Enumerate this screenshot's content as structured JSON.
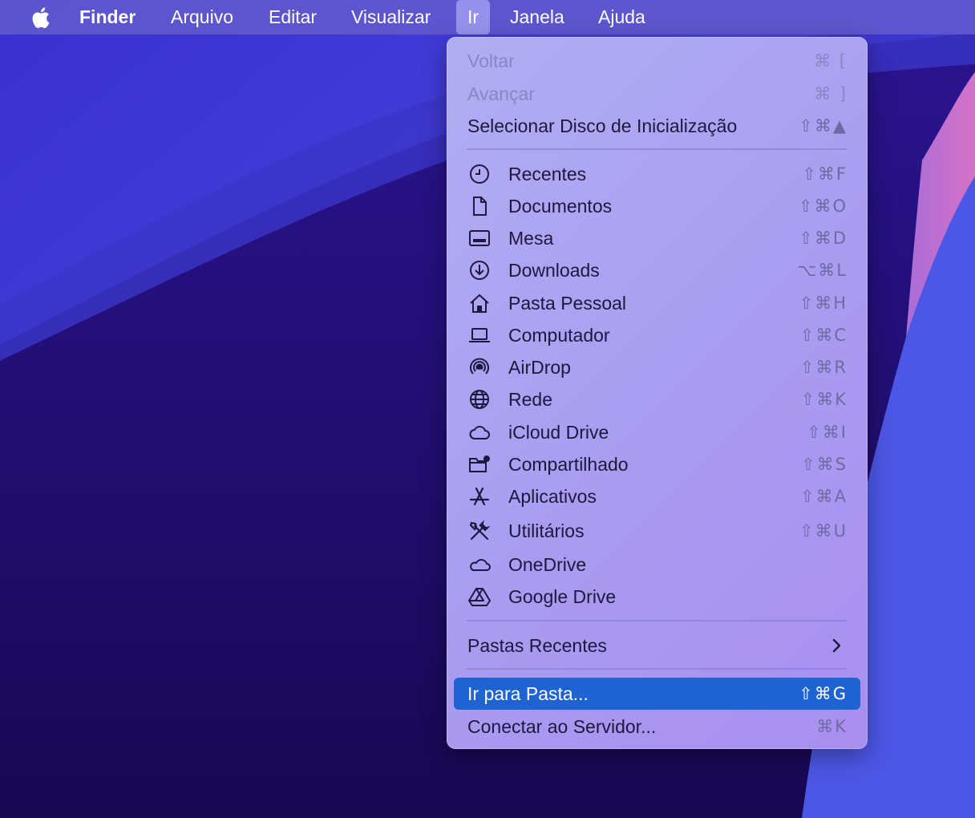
{
  "menubar": {
    "apple_icon": "apple-logo-icon",
    "items": [
      {
        "label": "Finder"
      },
      {
        "label": "Arquivo"
      },
      {
        "label": "Editar"
      },
      {
        "label": "Visualizar"
      },
      {
        "label": "Ir"
      },
      {
        "label": "Janela"
      },
      {
        "label": "Ajuda"
      }
    ],
    "active_item": "Ir"
  },
  "menu": {
    "section_navigation": [
      {
        "label": "Voltar",
        "shortcut": "⌘ [",
        "enabled": false
      },
      {
        "label": "Avançar",
        "shortcut": "⌘ ]",
        "enabled": false
      },
      {
        "label": "Selecionar Disco de Inicialização",
        "shortcut": "⇧⌘▲",
        "enabled": true
      }
    ],
    "section_places": [
      {
        "label": "Recentes",
        "shortcut": "⇧⌘F",
        "icon": "clock-icon"
      },
      {
        "label": "Documentos",
        "shortcut": "⇧⌘O",
        "icon": "document-icon"
      },
      {
        "label": "Mesa",
        "shortcut": "⇧⌘D",
        "icon": "desktop-icon"
      },
      {
        "label": "Downloads",
        "shortcut": "⌥⌘L",
        "icon": "download-icon"
      },
      {
        "label": "Pasta Pessoal",
        "shortcut": "⇧⌘H",
        "icon": "home-icon"
      },
      {
        "label": "Computador",
        "shortcut": "⇧⌘C",
        "icon": "laptop-icon"
      },
      {
        "label": "AirDrop",
        "shortcut": "⇧⌘R",
        "icon": "airdrop-icon"
      },
      {
        "label": "Rede",
        "shortcut": "⇧⌘K",
        "icon": "globe-icon"
      },
      {
        "label": "iCloud Drive",
        "shortcut": "⇧⌘I",
        "icon": "cloud-icon"
      },
      {
        "label": "Compartilhado",
        "shortcut": "⇧⌘S",
        "icon": "shared-folder-icon"
      },
      {
        "label": "Aplicativos",
        "shortcut": "⇧⌘A",
        "icon": "app-store-icon"
      },
      {
        "label": "Utilitários",
        "shortcut": "⇧⌘U",
        "icon": "tools-icon"
      },
      {
        "label": "OneDrive",
        "shortcut": "",
        "icon": "cloud-icon"
      },
      {
        "label": "Google Drive",
        "shortcut": "",
        "icon": "google-drive-icon"
      }
    ],
    "recent_folders": {
      "label": "Pastas Recentes",
      "icon": "chevron-right-icon"
    },
    "section_goto": [
      {
        "label": "Ir para Pasta...",
        "shortcut": "⇧⌘G",
        "selected": true
      },
      {
        "label": "Conectar ao Servidor...",
        "shortcut": "⌘K",
        "selected": false
      }
    ]
  },
  "colors": {
    "menubar": "#5f58cd",
    "menu_background": "#aba4f1",
    "selection": "#1f62d2",
    "disabled_text": "#8a86c4"
  }
}
